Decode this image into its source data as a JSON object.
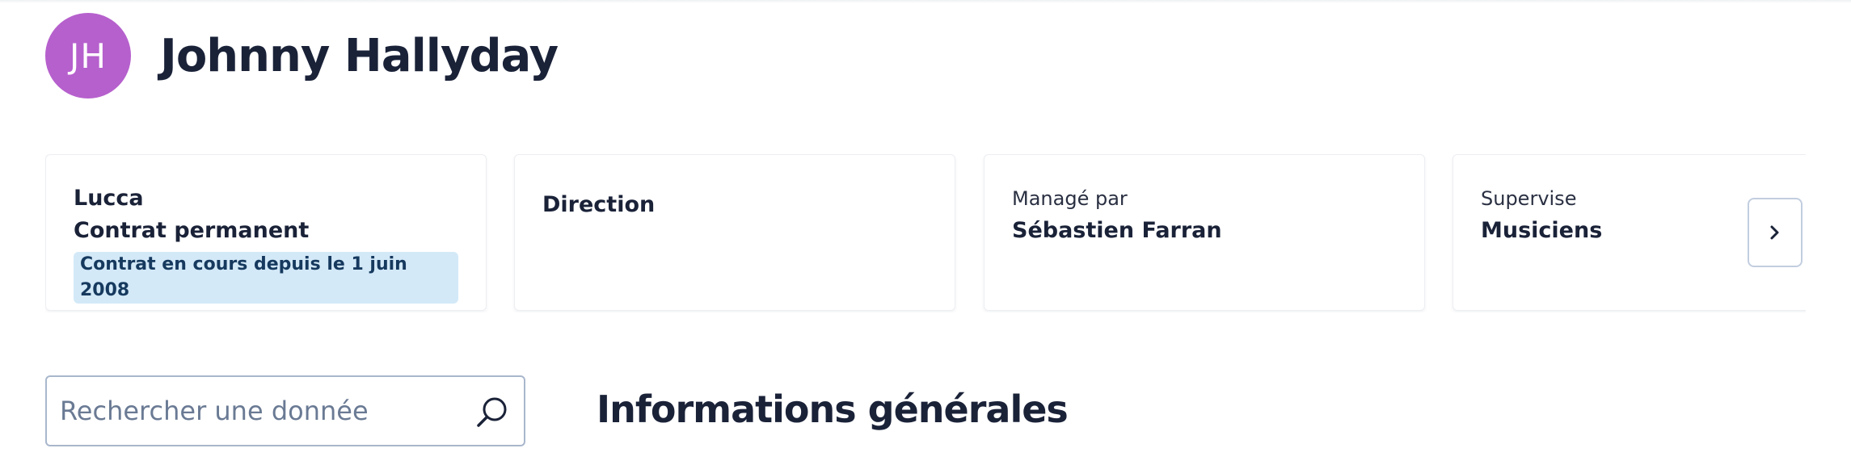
{
  "header": {
    "avatar_initials": "JH",
    "avatar_color": "#b660cd",
    "name": "Johnny Hallyday"
  },
  "cards": {
    "company": {
      "name": "Lucca",
      "contract_type": "Contrat permanent",
      "contract_badge": "Contrat en cours depuis le 1 juin 2008"
    },
    "department": {
      "label": "Direction"
    },
    "manager": {
      "caption": "Managé par",
      "value": "Sébastien Farran"
    },
    "supervises": {
      "caption": "Supervise",
      "value": "Musiciens"
    },
    "next_icon": "chevron-right-icon"
  },
  "search": {
    "placeholder": "Rechercher une donnée",
    "value": "",
    "icon": "search-icon"
  },
  "section": {
    "title": "Informations générales"
  },
  "colors": {
    "text": "#1a2238",
    "badge_bg": "#d3e9f8",
    "border": "#a9b7cc"
  }
}
